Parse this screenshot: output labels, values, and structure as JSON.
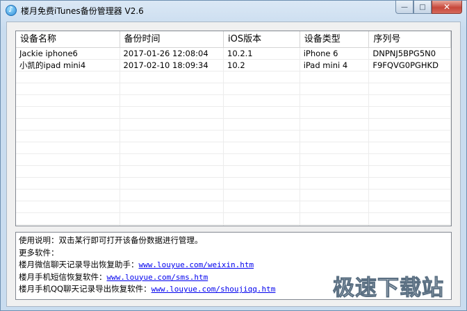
{
  "window": {
    "title": "楼月免费iTunes备份管理器 V2.6"
  },
  "controls": {
    "minimize": "—",
    "maximize": "□",
    "close": "✕"
  },
  "table": {
    "columns": [
      "设备名称",
      "备份时间",
      "iOS版本",
      "设备类型",
      "序列号"
    ],
    "rows": [
      [
        "Jackie iphone6",
        "2017-01-26 12:08:04",
        "10.2.1",
        "iPhone 6",
        "DNPNJ5BPG5N0"
      ],
      [
        "小凯的ipad mini4",
        "2017-02-10 18:09:34",
        "10.2",
        "iPad mini 4",
        "F9FQVG0PGHKD"
      ]
    ]
  },
  "info": {
    "usage": "使用说明：双击某行即可打开该备份数据进行管理。",
    "more": "更多软件：",
    "links": [
      {
        "label": "楼月微信聊天记录导出恢复助手：",
        "url": "www.louyue.com/weixin.htm"
      },
      {
        "label": "楼月手机短信恢复软件：",
        "url": "www.louyue.com/sms.htm"
      },
      {
        "label": "楼月手机QQ聊天记录导出恢复软件：",
        "url": "www.louyue.com/shoujiqq.htm"
      }
    ]
  },
  "watermark": "极速下载站"
}
